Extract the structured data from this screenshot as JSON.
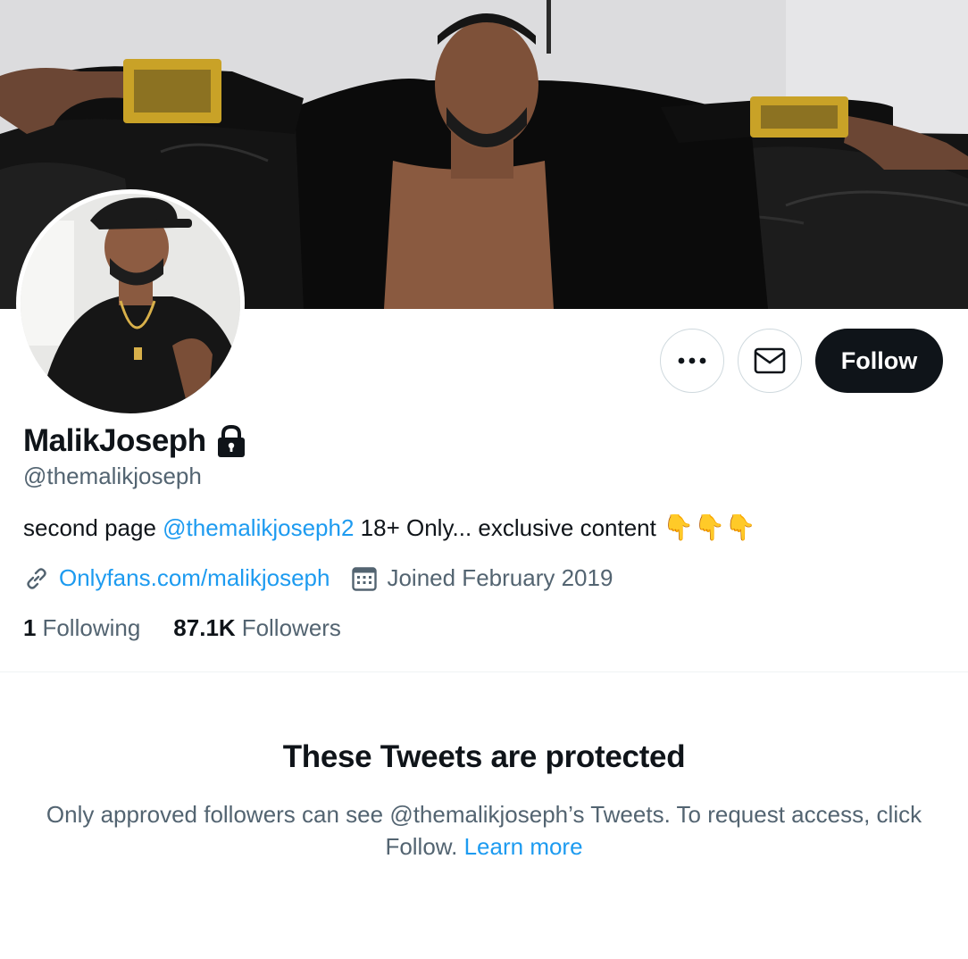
{
  "profile": {
    "display_name": "MalikJoseph",
    "handle": "@themalikjoseph",
    "bio": {
      "prefix": "second page ",
      "mention": "@themalikjoseph2",
      "suffix": " 18+ Only... exclusive content ",
      "emoji": "👇👇👇"
    },
    "website": "Onlyfans.com/malikjoseph",
    "joined": "Joined February 2019",
    "stats": {
      "following_count": "1",
      "following_label": "Following",
      "followers_count": "87.1K",
      "followers_label": "Followers"
    }
  },
  "actions": {
    "follow_label": "Follow"
  },
  "protected": {
    "title": "These Tweets are protected",
    "message": "Only approved followers can see @themalikjoseph’s Tweets. To request access, click Follow. ",
    "learn_more": "Learn more"
  },
  "colors": {
    "accent": "#1d9bf0",
    "text_primary": "#0f1419",
    "text_secondary": "#536471",
    "follow_button_bg": "#0f1419"
  },
  "icons": [
    "more-icon",
    "mail-icon",
    "lock-icon",
    "link-icon",
    "calendar-icon"
  ]
}
